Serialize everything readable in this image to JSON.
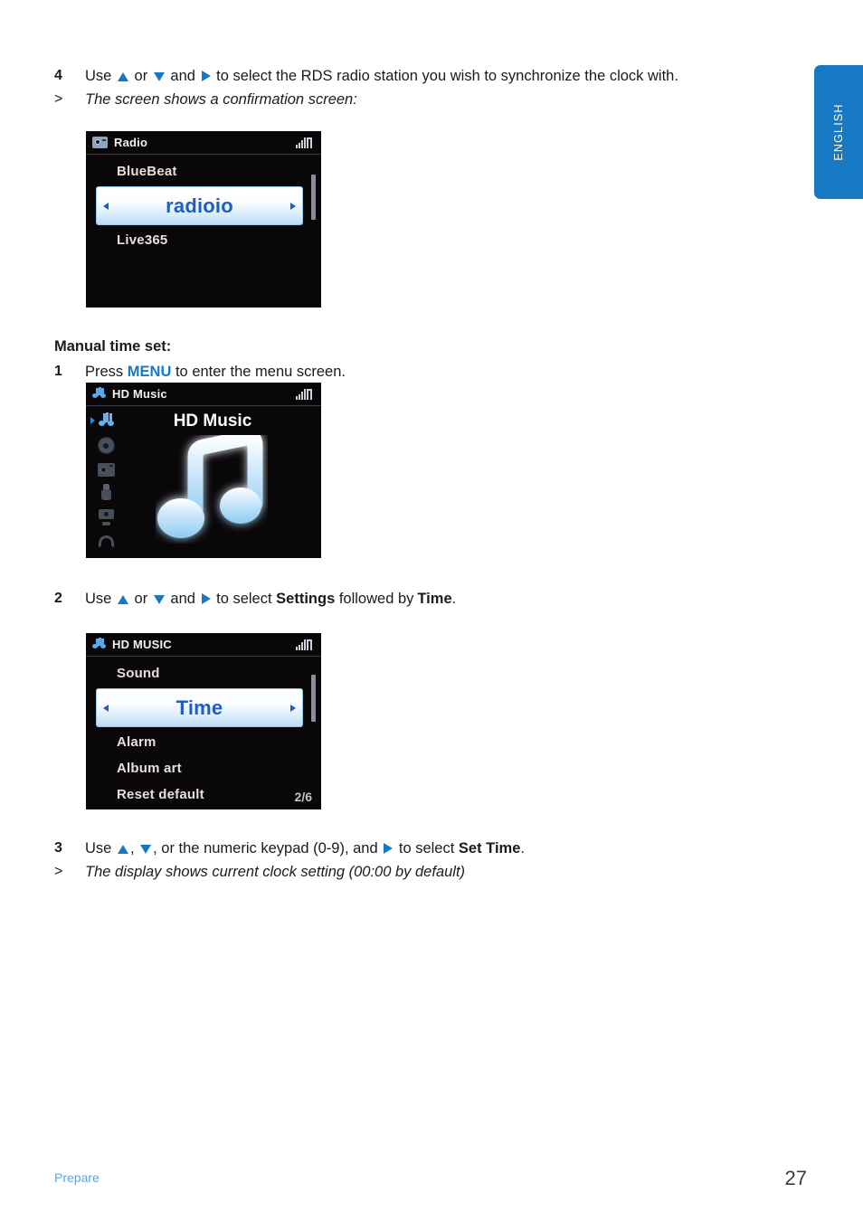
{
  "language_tab": {
    "label": "ENGLISH"
  },
  "steps": {
    "step4": {
      "number": "4",
      "text_a": "Use",
      "text_b": "or",
      "text_c": "and",
      "text_d": "to select the RDS radio station you wish to synchronize the clock with."
    },
    "note4": {
      "marker": ">",
      "text": "The screen shows a confirmation screen:"
    },
    "section_heading": "Manual time set:",
    "step1": {
      "number": "1",
      "text_a": "Press",
      "keyword": "MENU",
      "text_b": "to enter the menu screen."
    },
    "step2": {
      "number": "2",
      "text_a": "Use",
      "text_b": "or",
      "text_c": "and",
      "text_d": "to select",
      "bold_a": "Settings",
      "text_e": "followed by",
      "bold_b": "Time",
      "text_f": "."
    },
    "step3": {
      "number": "3",
      "text_a": "Use",
      "text_b": ",",
      "text_c": ", or the numeric keypad (0-9), and",
      "text_d": "to select",
      "bold_a": "Set Time",
      "text_e": "."
    },
    "note3": {
      "marker": ">",
      "text": "The display shows current clock setting (00:00 by default)"
    }
  },
  "screens": {
    "radio": {
      "header_title": "Radio",
      "header_icon": "radio-icon",
      "signal_icon": "signal-strength-icon",
      "items": [
        {
          "label": "BlueBeat",
          "selected": false
        },
        {
          "label": "radioio",
          "selected": true
        },
        {
          "label": "Live365",
          "selected": false
        }
      ]
    },
    "hd_music_splash": {
      "header_title": "HD Music",
      "header_icon": "music-note-icon",
      "signal_icon": "signal-strength-icon",
      "splash_title": "HD Music",
      "sidebar_icons": [
        "music-note-icon",
        "disc-icon",
        "internet-radio-icon",
        "usb-icon",
        "pc-link-icon",
        "return-icon"
      ]
    },
    "settings": {
      "header_title": "HD MUSIC",
      "header_icon": "music-note-icon",
      "signal_icon": "signal-strength-icon",
      "items": [
        {
          "label": "Sound",
          "selected": false
        },
        {
          "label": "Time",
          "selected": true
        },
        {
          "label": "Alarm",
          "selected": false
        },
        {
          "label": "Album art",
          "selected": false
        },
        {
          "label": "Reset default",
          "selected": false
        }
      ],
      "page_indicator": "2/6"
    }
  },
  "footer": {
    "section_label": "Prepare",
    "page_number": "27"
  }
}
